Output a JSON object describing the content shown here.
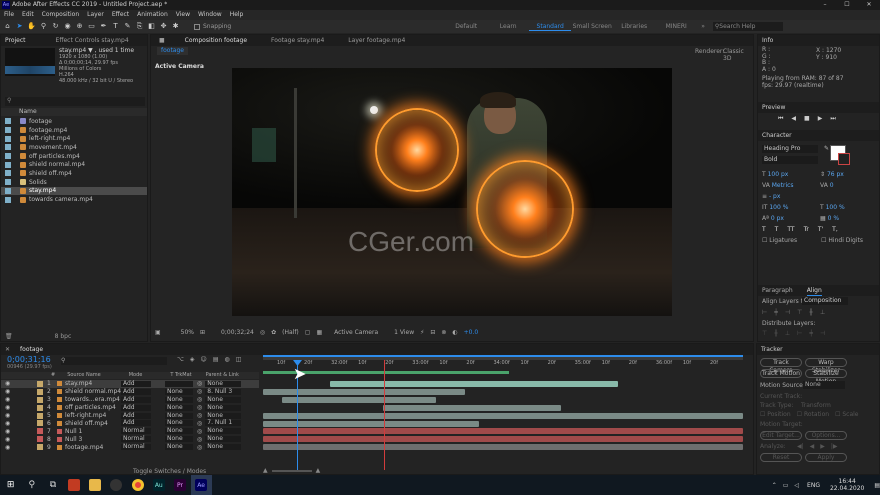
{
  "title": "Adobe After Effects CC 2019 - Untitled Project.aep *",
  "menu": [
    "File",
    "Edit",
    "Composition",
    "Layer",
    "Effect",
    "Animation",
    "View",
    "Window",
    "Help"
  ],
  "snapping": "Snapping",
  "workspaces": [
    "Default",
    "Learn",
    "Standard",
    "Small Screen",
    "Libraries",
    "MINERI"
  ],
  "search_help": "Search Help",
  "project": {
    "tab": "Project",
    "fx_tab": "Effect Controls stay.mp4",
    "preview_name": "stay.mp4 ▼ , used 1 time",
    "preview_info": [
      "1920 x 1080 (1.00)",
      "Δ 0;00;00;14, 29.97 fps",
      "Millions of Colors",
      "H.264",
      "48.000 kHz / 32 bit U / Stereo"
    ],
    "col_name": "Name",
    "items": [
      {
        "name": "footage",
        "icon": "comp"
      },
      {
        "name": "footage.mp4",
        "icon": "vid"
      },
      {
        "name": "left-right.mp4",
        "icon": "vid"
      },
      {
        "name": "movement.mp4",
        "icon": "vid"
      },
      {
        "name": "off particles.mp4",
        "icon": "vid"
      },
      {
        "name": "shield normal.mp4",
        "icon": "vid"
      },
      {
        "name": "shield off.mp4",
        "icon": "vid"
      },
      {
        "name": "Solids",
        "icon": "folder"
      },
      {
        "name": "stay.mp4",
        "icon": "vid",
        "selected": true
      },
      {
        "name": "towards camera.mp4",
        "icon": "vid"
      }
    ],
    "bpc": "8 bpc"
  },
  "comp": {
    "tab": "Composition footage",
    "tab2": "Footage stay.mp4",
    "tab3": "Layer footage.mp4",
    "sub": "footage",
    "renderer": "Renderer:",
    "renderer_val": "Classic 3D",
    "active_camera": "Active Camera",
    "zoom": "50%",
    "time": "0;00;32;24",
    "quality": "(Half)",
    "camera": "Active Camera",
    "views": "1 View",
    "offset": "+0.0"
  },
  "watermark": "CGer.com",
  "info": {
    "tab": "Info",
    "rgb": [
      "R :",
      "G :",
      "B :",
      "A : 0"
    ],
    "x": "X : 1270",
    "y": "Y : 910",
    "playing": "Playing from RAM: 87 of 87",
    "fps": "fps: 29.97 (realtime)"
  },
  "preview": {
    "tab": "Preview"
  },
  "character": {
    "tab": "Character",
    "font": "Heading Pro",
    "style": "Bold",
    "size": "100 px",
    "leading": "76 px",
    "kern": "Metrics",
    "track": "0",
    "stroke": "- px",
    "vscale": "100 %",
    "hscale": "100 %",
    "baseline": "0 px",
    "tsume": "0 %",
    "ligatures": "Ligatures",
    "hindi": "Hindi Digits",
    "styles": [
      "T",
      "T",
      "TT",
      "Tr",
      "T'",
      "T,"
    ]
  },
  "paragraph": {
    "tab": "Paragraph",
    "align_tab": "Align",
    "align_to": "Align Layers to:",
    "align_val": "Composition",
    "distribute": "Distribute Layers:"
  },
  "tracker": {
    "tab": "Tracker",
    "buttons": [
      "Track Camera",
      "Warp Stabilizer",
      "Track Motion",
      "Stabilize Motion"
    ],
    "motion_source": "Motion Source:",
    "ms_val": "None",
    "current_track": "Current Track:",
    "track_type": "Track Type:",
    "tt_val": "Transform",
    "position": "Position",
    "rotation": "Rotation",
    "scale": "Scale",
    "motion_target": "Motion Target:",
    "edit_target": "Edit Target...",
    "options": "Options...",
    "analyze": "Analyze:",
    "reset": "Reset",
    "apply": "Apply"
  },
  "timeline": {
    "tab": "footage",
    "timecode": "0;00;31;16",
    "fps": "00946 (29.97 fps)",
    "cols": [
      "#",
      "Source Name",
      "Mode",
      "T TrkMat",
      "Parent & Link"
    ],
    "ruler": [
      "10f",
      "20f",
      "32:00f",
      "10f",
      "20f",
      "33:00f",
      "10f",
      "20f",
      "34:00f",
      "10f",
      "20f",
      "35:00f",
      "10f",
      "20f",
      "36:00f",
      "10f",
      "20f"
    ],
    "toggle": "Toggle Switches / Modes",
    "layers": [
      {
        "num": "1",
        "name": "stay.mp4",
        "mode": "Add",
        "trk": "",
        "parent": "None",
        "color": "#c6a86a",
        "bar": "#88b9a9",
        "start": 0.14,
        "end": 0.74,
        "selected": true
      },
      {
        "num": "2",
        "name": "shield normal.mp4",
        "mode": "Add",
        "trk": "None",
        "parent": "8. Null 3",
        "color": "#c6a86a",
        "bar": "#7a8a86",
        "start": 0.0,
        "end": 0.42
      },
      {
        "num": "3",
        "name": "towards...era.mp4",
        "mode": "Add",
        "trk": "None",
        "parent": "None",
        "color": "#c6a86a",
        "bar": "#7a8a86",
        "start": 0.04,
        "end": 0.36
      },
      {
        "num": "4",
        "name": "off particles.mp4",
        "mode": "Add",
        "trk": "None",
        "parent": "None",
        "color": "#c6a86a",
        "bar": "#7a8a86",
        "start": 0.25,
        "end": 0.62
      },
      {
        "num": "5",
        "name": "left-right.mp4",
        "mode": "Add",
        "trk": "None",
        "parent": "None",
        "color": "#c6a86a",
        "bar": "#7a8a86",
        "start": 0.0,
        "end": 1.0
      },
      {
        "num": "6",
        "name": "shield off.mp4",
        "mode": "Add",
        "trk": "None",
        "parent": "7. Null 1",
        "color": "#c6a86a",
        "bar": "#7a8a86",
        "start": 0.0,
        "end": 0.45
      },
      {
        "num": "7",
        "name": "Null 1",
        "mode": "Normal",
        "trk": "None",
        "parent": "None",
        "color": "#c65a5a",
        "bar": "#a04a4a",
        "start": 0.0,
        "end": 1.0
      },
      {
        "num": "8",
        "name": "Null 3",
        "mode": "Normal",
        "trk": "None",
        "parent": "None",
        "color": "#c65a5a",
        "bar": "#a04a4a",
        "start": 0.0,
        "end": 1.0
      },
      {
        "num": "9",
        "name": "footage.mp4",
        "mode": "Normal",
        "trk": "None",
        "parent": "None",
        "color": "#c6a86a",
        "bar": "#6e6e6e",
        "start": 0.0,
        "end": 1.0
      }
    ]
  },
  "taskbar": {
    "lang": "ENG",
    "time": "16:44",
    "date": "22.04.2020"
  },
  "colors": {
    "accent": "#2d8ceb",
    "playhead": "#2d8ceb",
    "cti_red": "#d23c3c"
  }
}
